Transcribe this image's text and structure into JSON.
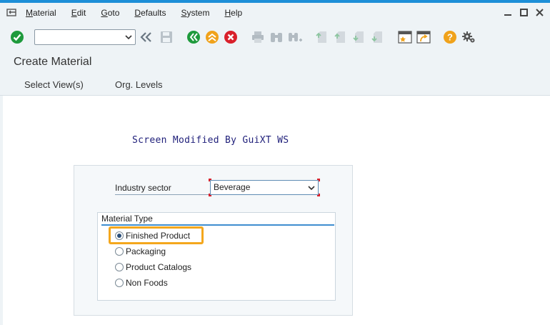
{
  "menu": {
    "items": [
      {
        "mnemonic": "M",
        "rest": "aterial"
      },
      {
        "mnemonic": "E",
        "rest": "dit"
      },
      {
        "mnemonic": "G",
        "rest": "oto"
      },
      {
        "mnemonic": "D",
        "rest": "efaults"
      },
      {
        "mnemonic": "S",
        "rest": "ystem"
      },
      {
        "mnemonic": "H",
        "rest": "elp"
      }
    ]
  },
  "toolbar": {
    "command_field_value": ""
  },
  "screen": {
    "title": "Create Material"
  },
  "app_toolbar": {
    "select_views": "Select View(s)",
    "org_levels": "Org. Levels"
  },
  "content": {
    "guixt_note": "Screen Modified By GuiXT WS",
    "industry_sector": {
      "label": "Industry sector",
      "value": "Beverage"
    },
    "material_type": {
      "title": "Material Type",
      "options": [
        {
          "label": "Finished Product",
          "selected": true
        },
        {
          "label": "Packaging",
          "selected": false
        },
        {
          "label": "Product Catalogs",
          "selected": false
        },
        {
          "label": "Non Foods",
          "selected": false
        }
      ]
    }
  },
  "colors": {
    "accent": "#1d8fd8",
    "focus": "#f4a71d",
    "ok_green": "#1e9a3c",
    "cancel_red": "#d9202b",
    "help_orange": "#f0a21b"
  }
}
